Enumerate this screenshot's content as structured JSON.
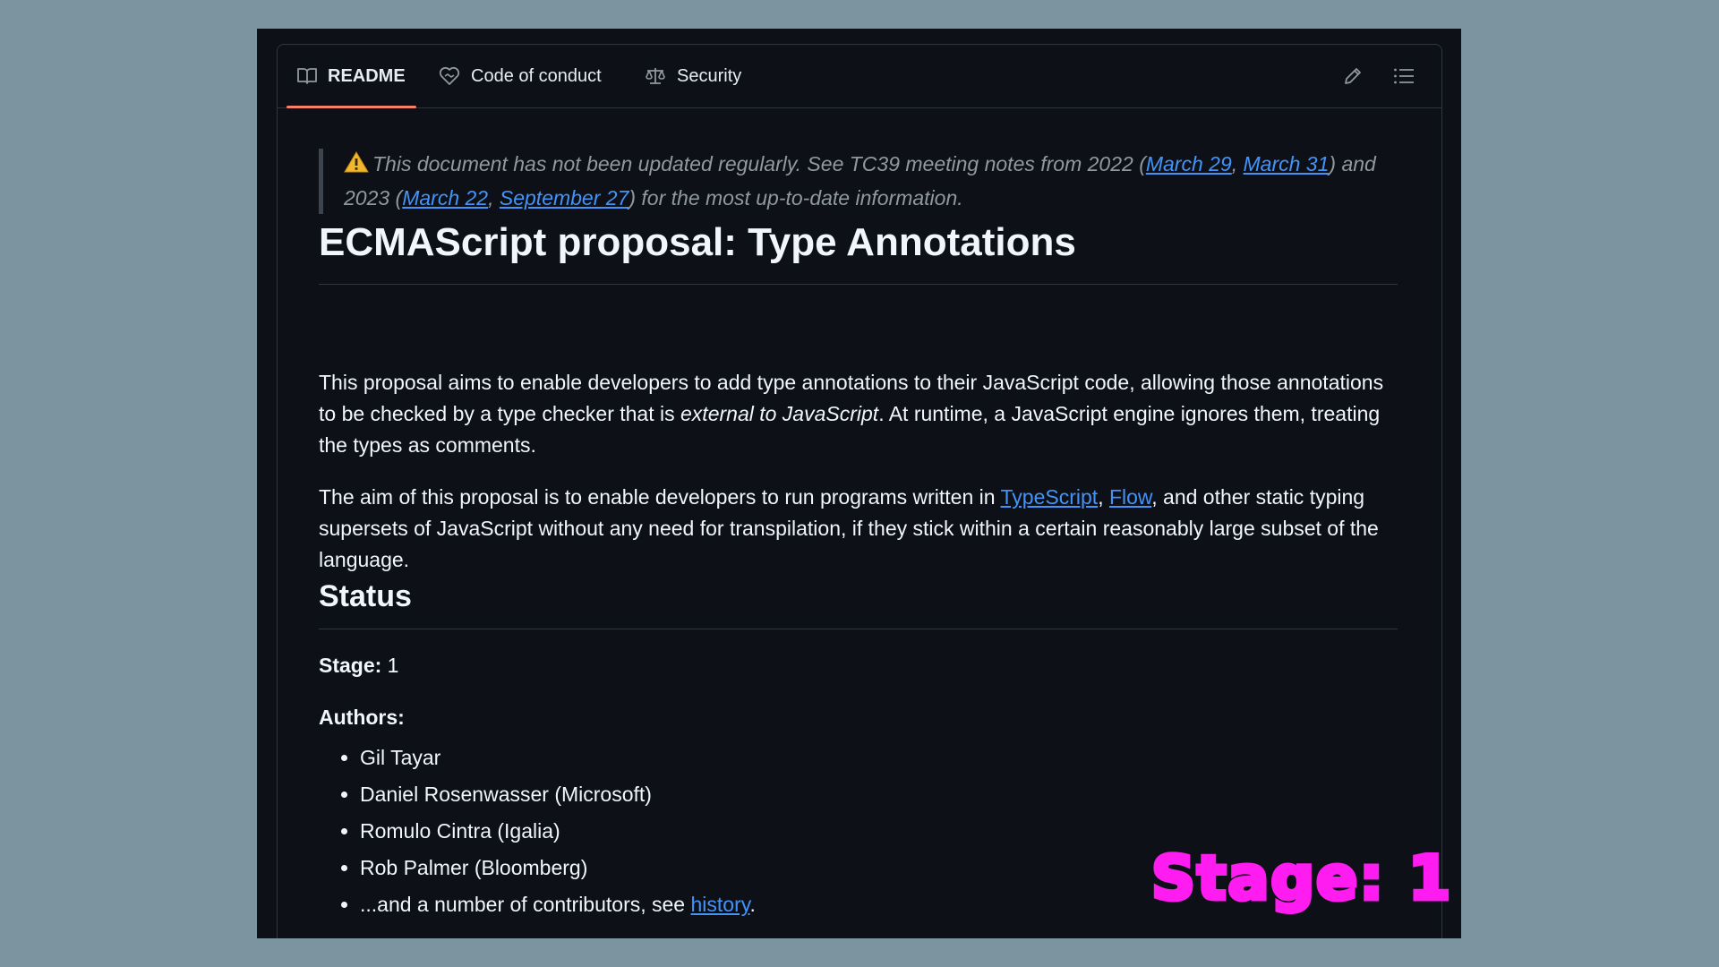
{
  "tabs": [
    {
      "label": "README",
      "icon": "book-icon",
      "active": true
    },
    {
      "label": "Code of conduct",
      "icon": "heart-handshake-icon",
      "active": false
    },
    {
      "label": "Security",
      "icon": "law-scale-icon",
      "active": false
    }
  ],
  "toolbar": {
    "edit_icon": "pencil-icon",
    "outline_icon": "list-icon"
  },
  "note": {
    "warning_icon": "warning-icon",
    "text_before": "This document has not been updated regularly. See TC39 meeting notes from 2022 (",
    "link1": "March 29",
    "sep1": ", ",
    "link2": "March 31",
    "text_mid": ") and 2023 (",
    "link3": "March 22",
    "sep2": ", ",
    "link4": "September 27",
    "text_after": ") for the most up-to-date information."
  },
  "title": "ECMAScript proposal: Type Annotations",
  "para1": {
    "before": "This proposal aims to enable developers to add type annotations to their JavaScript code, allowing those annotations to be checked by a type checker that is ",
    "emph": "external to JavaScript",
    "after": ". At runtime, a JavaScript engine ignores them, treating the types as comments."
  },
  "para2": {
    "before": "The aim of this proposal is to enable developers to run programs written in ",
    "link1": "TypeScript",
    "sep": ", ",
    "link2": "Flow",
    "after": ", and other static typing supersets of JavaScript without any need for transpilation, if they stick within a certain reasonably large subset of the language."
  },
  "status_heading": "Status",
  "stage": {
    "label": "Stage:",
    "value": " 1"
  },
  "authors_label": "Authors:",
  "authors": [
    {
      "text": "Gil Tayar"
    },
    {
      "text": "Daniel Rosenwasser (Microsoft)"
    },
    {
      "text": "Romulo Cintra (Igalia)"
    },
    {
      "text": "Rob Palmer (Bloomberg)"
    },
    {
      "text": "...and a number of contributors, see ",
      "link": "history",
      "after": "."
    }
  ],
  "overlay": "Stage: 1",
  "colors": {
    "accent": "#f78166",
    "link": "#4493f8",
    "overlay": "#ff1cf0",
    "background": "#0d1117"
  }
}
